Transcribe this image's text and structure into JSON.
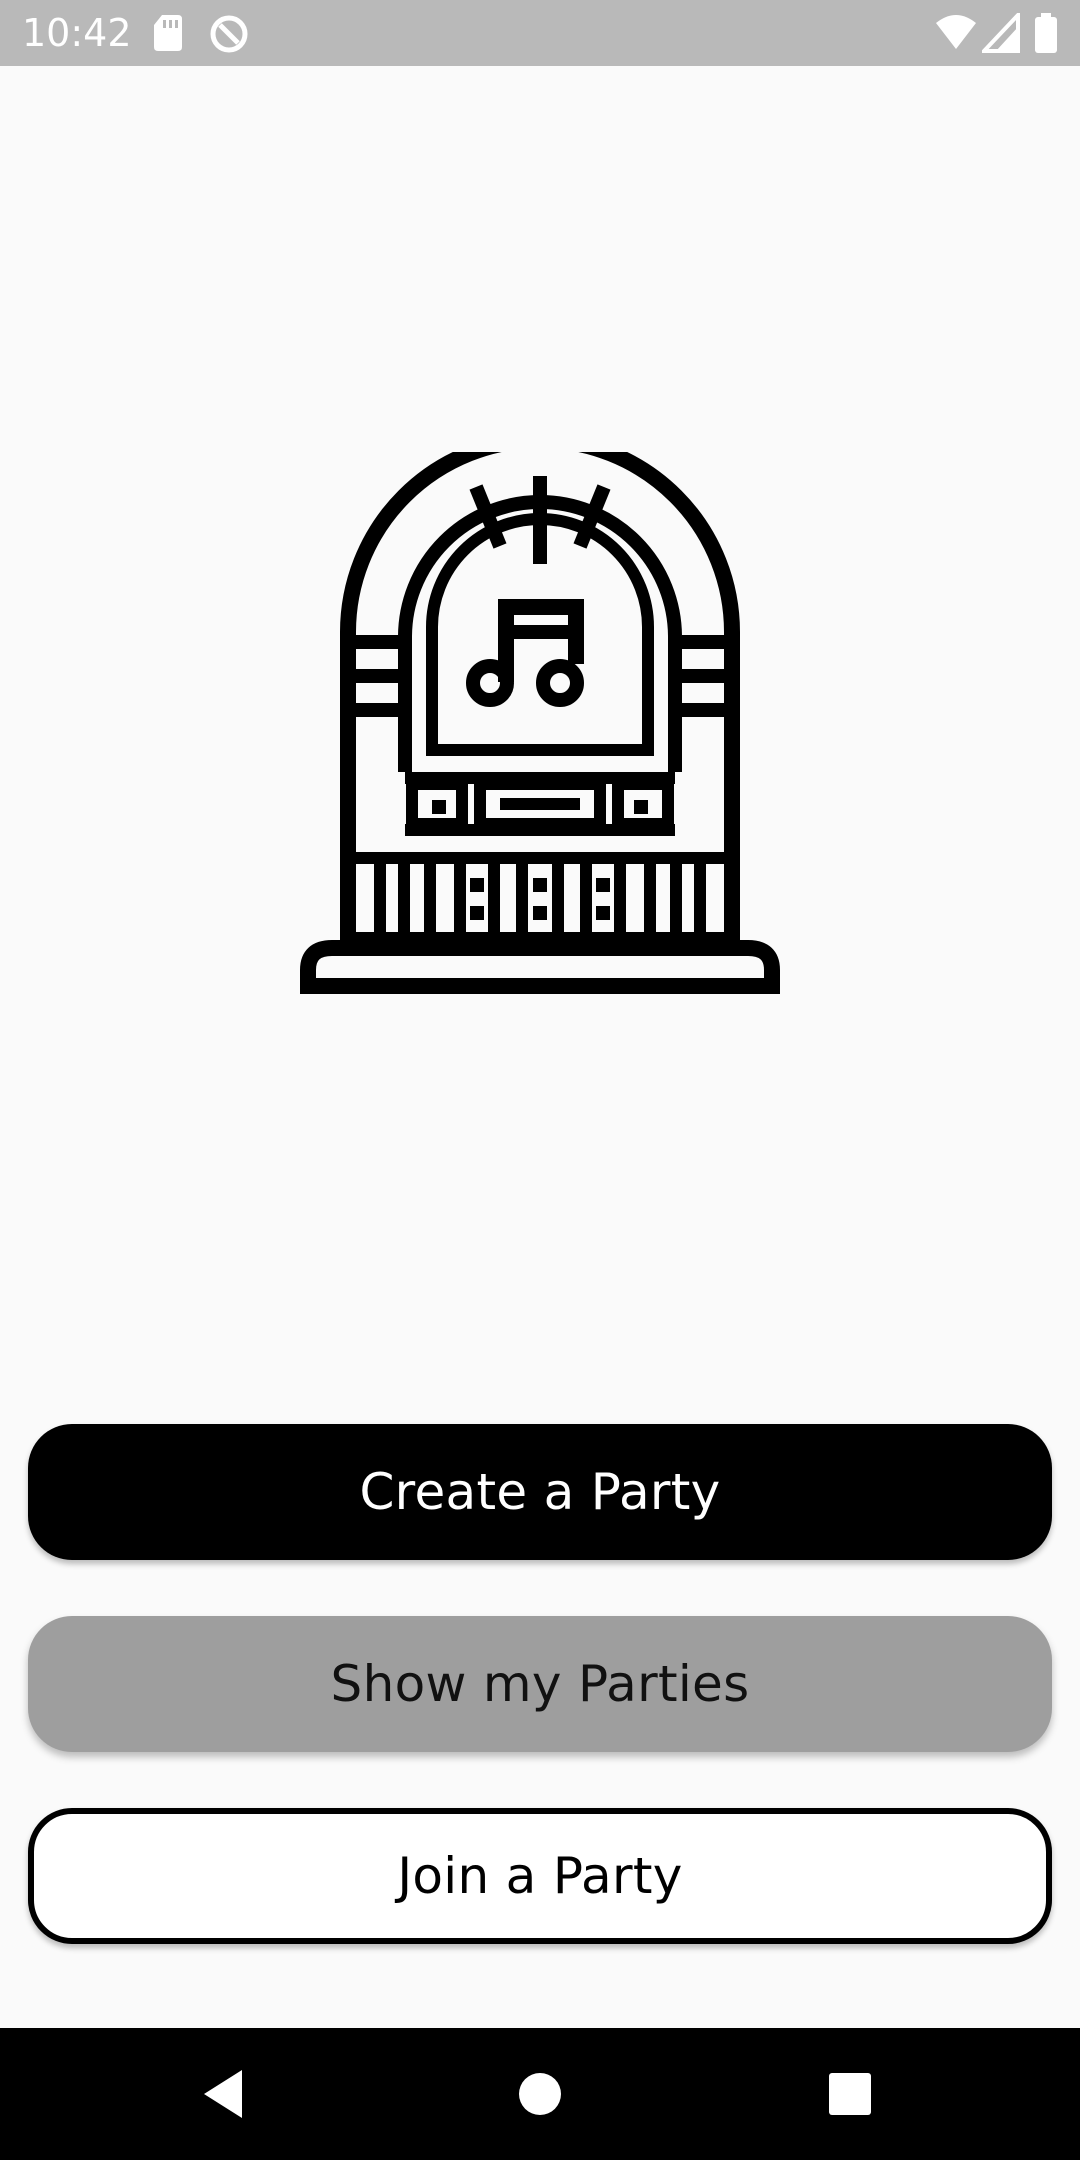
{
  "status_bar": {
    "time": "10:42",
    "icons": [
      "sd-card-icon",
      "data-saver-icon",
      "wifi-icon",
      "signal-icon",
      "battery-icon"
    ]
  },
  "main": {
    "logo_icon": "jukebox-icon",
    "buttons": {
      "create": "Create a Party",
      "show": "Show my Parties",
      "join": "Join a Party"
    }
  },
  "nav_bar": {
    "icons": [
      "back-icon",
      "home-icon",
      "recents-icon"
    ]
  },
  "colors": {
    "background": "#fafafa",
    "primary": "#000000",
    "secondary": "#9e9e9e",
    "status_bar": "#b9b9b9"
  }
}
